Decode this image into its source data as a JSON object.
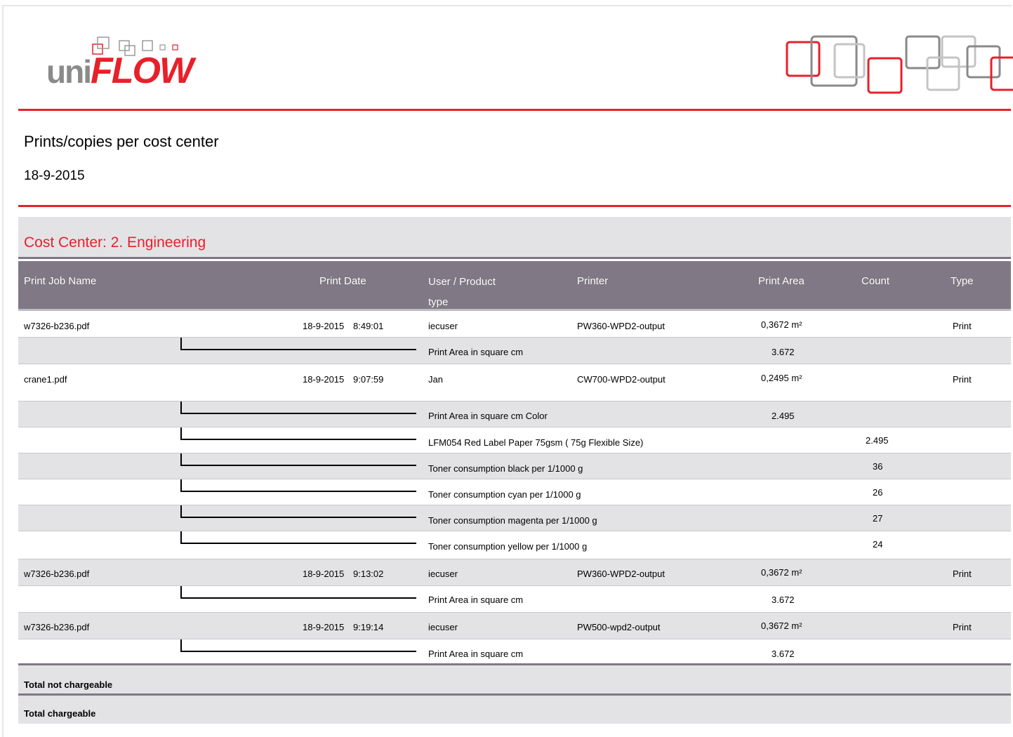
{
  "logo": {
    "part1": "uni",
    "part2": "FLOW"
  },
  "report": {
    "title": "Prints/copies per cost center",
    "date": "18-9-2015"
  },
  "cost_center": {
    "title": "Cost Center: 2. Engineering"
  },
  "columns": {
    "job_name": "Print Job Name",
    "print_date": "Print Date",
    "user_product_line1": "User / Product",
    "user_product_line2": "type",
    "printer": "Printer",
    "print_area": "Print Area",
    "count": "Count",
    "type": "Type"
  },
  "rows": [
    {
      "job": "w7326-b236.pdf",
      "date": "18-9-2015",
      "time": "8:49:01",
      "user": "iecuser",
      "printer": "PW360-WPD2-output",
      "area": "0,3672 m²",
      "count": "",
      "type": "Print"
    },
    {
      "detail": "Print Area in square cm",
      "area": "3.672",
      "count": ""
    },
    {
      "job": "crane1.pdf",
      "date": "18-9-2015",
      "time": "9:07:59",
      "user": "Jan",
      "printer": "CW700-WPD2-output",
      "area": "0,2495 m²",
      "count": "",
      "type": "Print"
    },
    {
      "detail": "Print Area in square cm Color",
      "area": "2.495",
      "count": ""
    },
    {
      "detail": "LFM054 Red Label Paper 75gsm ( 75g Flexible Size)",
      "area": "",
      "count": "2.495"
    },
    {
      "detail": "Toner consumption black per 1/1000 g",
      "area": "",
      "count": "36"
    },
    {
      "detail": "Toner consumption cyan per 1/1000 g",
      "area": "",
      "count": "26"
    },
    {
      "detail": "Toner consumption magenta per 1/1000 g",
      "area": "",
      "count": "27"
    },
    {
      "detail": "Toner consumption yellow per 1/1000 g",
      "area": "",
      "count": "24"
    },
    {
      "job": "w7326-b236.pdf",
      "date": "18-9-2015",
      "time": "9:13:02",
      "user": "iecuser",
      "printer": "PW360-WPD2-output",
      "area": "0,3672 m²",
      "count": "",
      "type": "Print"
    },
    {
      "detail": "Print Area in square cm",
      "area": "3.672",
      "count": ""
    },
    {
      "job": "w7326-b236.pdf",
      "date": "18-9-2015",
      "time": "9:19:14",
      "user": "iecuser",
      "printer": "PW500-wpd2-output",
      "area": "0,3672 m²",
      "count": "",
      "type": "Print"
    },
    {
      "detail": "Print Area in square cm",
      "area": "3.672",
      "count": ""
    }
  ],
  "totals": {
    "not_chargeable": "Total not chargeable",
    "chargeable": "Total chargeable"
  },
  "colors": {
    "accent": "#e8202a",
    "header_bg": "#807885",
    "band_bg": "#e3e3e6",
    "logo_grey": "#8a8a8a"
  }
}
